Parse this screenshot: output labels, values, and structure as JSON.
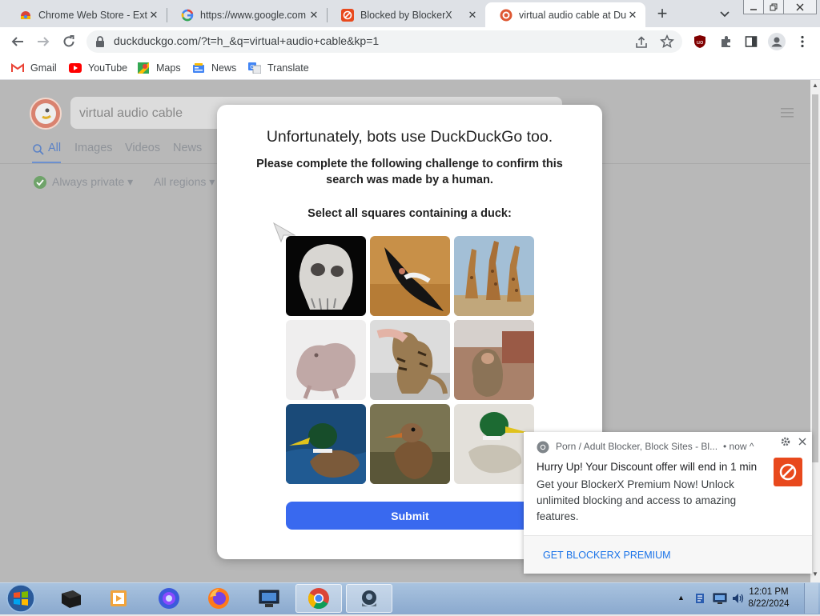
{
  "browser": {
    "tabs": [
      {
        "title": "Chrome Web Store - Exte",
        "icon": "chrome-web-store-icon",
        "active": false
      },
      {
        "title": "https://www.google.com",
        "icon": "google-icon",
        "active": false
      },
      {
        "title": "Blocked by BlockerX",
        "icon": "blockerx-icon",
        "active": false
      },
      {
        "title": "virtual audio cable at Duc",
        "icon": "duckduckgo-icon",
        "active": true
      }
    ],
    "new_tab_symbol": "+",
    "tab_close_symbol": "✕",
    "url": "duckduckgo.com/?t=h_&q=virtual+audio+cable&kp=1",
    "bookmarks": [
      {
        "label": "Gmail",
        "icon": "gmail-icon"
      },
      {
        "label": "YouTube",
        "icon": "youtube-icon"
      },
      {
        "label": "Maps",
        "icon": "maps-icon"
      },
      {
        "label": "News",
        "icon": "news-icon"
      },
      {
        "label": "Translate",
        "icon": "translate-icon"
      }
    ]
  },
  "ddg": {
    "query": "virtual audio cable",
    "nav": [
      "All",
      "Images",
      "Videos",
      "News"
    ],
    "filters": {
      "privacy": "Always private",
      "region": "All regions"
    }
  },
  "challenge": {
    "title": "Unfortunately, bots use DuckDuckGo too.",
    "subtitle": "Please complete the following challenge to confirm this search was made by a human.",
    "instruction": "Select all squares containing a duck:",
    "tiles": [
      "gorilla-skull",
      "condor",
      "giraffes",
      "hairless-rodent",
      "cat",
      "monkey",
      "duck",
      "duck",
      "duck"
    ],
    "submit_label": "Submit"
  },
  "notification": {
    "source": "Porn / Adult Blocker, Block Sites - Bl...",
    "time": "• now ^",
    "title": "Hurry Up! Your Discount offer will end in 1 min",
    "body": "Get your BlockerX Premium Now! Unlock unlimited blocking and access to amazing features.",
    "action": "GET BLOCKERX PREMIUM",
    "accent": "#e8491d"
  },
  "taskbar": {
    "time": "12:01 PM",
    "date": "8/22/2024"
  },
  "colors": {
    "submit": "#3969ef",
    "ddg_accent": "#de5833"
  }
}
